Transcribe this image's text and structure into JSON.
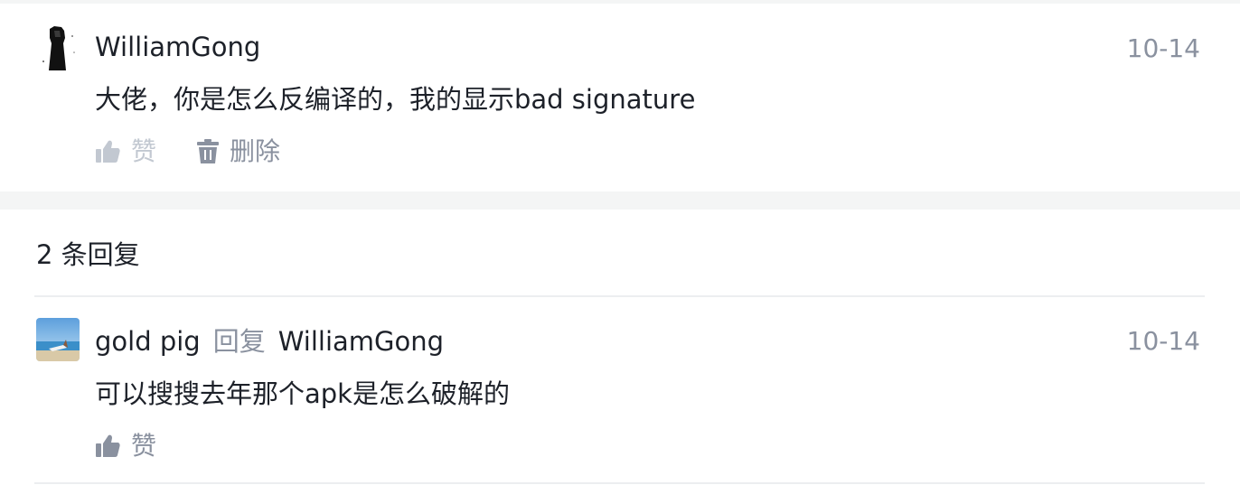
{
  "comment": {
    "username": "WilliamGong",
    "time": "10-14",
    "text": "大佬，你是怎么反编译的，我的显示bad signature",
    "like_label": "赞",
    "delete_label": "删除"
  },
  "replies_header": "2 条回复",
  "reply": {
    "username": "gold pig",
    "reply_word": "回复",
    "reply_to": "WilliamGong",
    "time": "10-14",
    "text": "可以搜搜去年那个apk是怎么破解的",
    "like_label": "赞"
  },
  "colors": {
    "text_primary": "#1d2129",
    "text_secondary": "#8a919f",
    "like_icon_inactive": "#c2c8d1",
    "icon_gray": "#8a919f",
    "separator": "#f4f5f5"
  }
}
